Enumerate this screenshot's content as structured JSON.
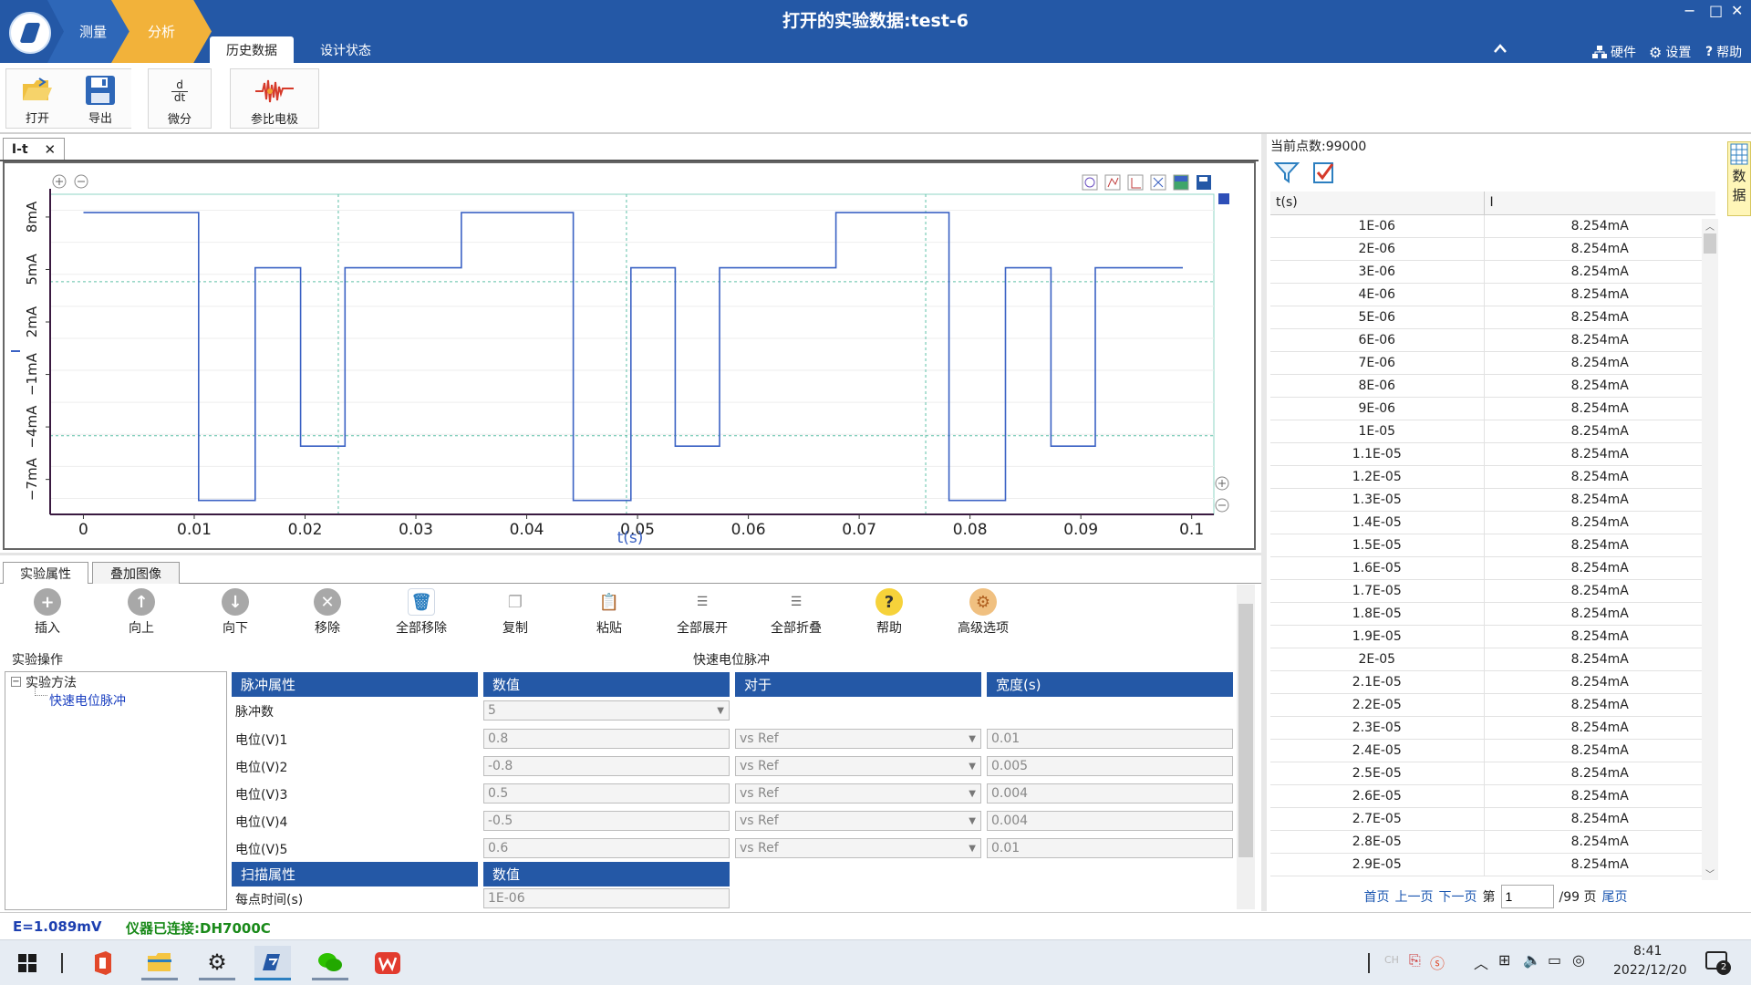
{
  "window": {
    "title": "打开的实验数据:test-6",
    "min": "−",
    "max": "□",
    "close": "✕"
  },
  "nav": {
    "measure": "测量",
    "analyze": "分析"
  },
  "ribbon_tabs": {
    "history": "历史数据",
    "design": "设计状态"
  },
  "top_right": {
    "hardware": "硬件",
    "settings": "设置",
    "help": "帮助"
  },
  "ribbon": {
    "open": "打开",
    "export": "导出",
    "derivative": "微分",
    "derivative_glyph_top": "d",
    "derivative_glyph_bottom": "dt",
    "reference": "参比电极"
  },
  "doc_tab": {
    "label": "I-t",
    "close": "✕"
  },
  "chart_data": {
    "type": "line",
    "xlabel": "t(s)",
    "ylabel": "I",
    "xlim": [
      -0.003,
      0.102
    ],
    "ylim": [
      -9,
      9.3
    ],
    "x_ticks": [
      "0",
      "0.01",
      "0.02",
      "0.03",
      "0.04",
      "0.05",
      "0.06",
      "0.07",
      "0.08",
      "0.09",
      "0.1"
    ],
    "y_ticks": [
      {
        "label": "8mA",
        "value": 8
      },
      {
        "label": "5mA",
        "value": 5
      },
      {
        "label": "2mA",
        "value": 2
      },
      {
        "label": "−1mA",
        "value": -1
      },
      {
        "label": "−4mA",
        "value": -4
      },
      {
        "label": "−7mA",
        "value": -7
      }
    ],
    "series": [
      {
        "color": "#3b62c4",
        "x": [
          0.0,
          0.0104,
          0.0104,
          0.0155,
          0.0155,
          0.0196,
          0.0196,
          0.0236,
          0.0236,
          0.0341,
          0.0341,
          0.0442,
          0.0442,
          0.0494,
          0.0494,
          0.0534,
          0.0534,
          0.0574,
          0.0574,
          0.0679,
          0.0679,
          0.0781,
          0.0781,
          0.0832,
          0.0832,
          0.0873,
          0.0873,
          0.0913,
          0.0913,
          0.0992
        ],
        "y": [
          8.25,
          8.25,
          -8.2,
          -8.2,
          5.1,
          5.1,
          -5.1,
          -5.1,
          5.1,
          5.1,
          8.25,
          8.25,
          -8.2,
          -8.2,
          5.1,
          5.1,
          -5.1,
          -5.1,
          5.1,
          5.1,
          8.25,
          8.25,
          -8.2,
          -8.2,
          5.1,
          5.1,
          -5.1,
          -5.1,
          5.1,
          5.1
        ]
      }
    ],
    "grid": true
  },
  "data_panel": {
    "point_count": "当前点数:99000",
    "col_t": "t(s)",
    "col_i": "I",
    "side_tab_1": "数",
    "side_tab_2": "据",
    "rows": [
      [
        "1E-06",
        "8.254mA"
      ],
      [
        "2E-06",
        "8.254mA"
      ],
      [
        "3E-06",
        "8.254mA"
      ],
      [
        "4E-06",
        "8.254mA"
      ],
      [
        "5E-06",
        "8.254mA"
      ],
      [
        "6E-06",
        "8.254mA"
      ],
      [
        "7E-06",
        "8.254mA"
      ],
      [
        "8E-06",
        "8.254mA"
      ],
      [
        "9E-06",
        "8.254mA"
      ],
      [
        "1E-05",
        "8.254mA"
      ],
      [
        "1.1E-05",
        "8.254mA"
      ],
      [
        "1.2E-05",
        "8.254mA"
      ],
      [
        "1.3E-05",
        "8.254mA"
      ],
      [
        "1.4E-05",
        "8.254mA"
      ],
      [
        "1.5E-05",
        "8.254mA"
      ],
      [
        "1.6E-05",
        "8.254mA"
      ],
      [
        "1.7E-05",
        "8.254mA"
      ],
      [
        "1.8E-05",
        "8.254mA"
      ],
      [
        "1.9E-05",
        "8.254mA"
      ],
      [
        "2E-05",
        "8.254mA"
      ],
      [
        "2.1E-05",
        "8.254mA"
      ],
      [
        "2.2E-05",
        "8.254mA"
      ],
      [
        "2.3E-05",
        "8.254mA"
      ],
      [
        "2.4E-05",
        "8.254mA"
      ],
      [
        "2.5E-05",
        "8.254mA"
      ],
      [
        "2.6E-05",
        "8.254mA"
      ],
      [
        "2.7E-05",
        "8.254mA"
      ],
      [
        "2.8E-05",
        "8.254mA"
      ],
      [
        "2.9E-05",
        "8.254mA"
      ]
    ],
    "pager": {
      "first": "首页",
      "prev": "上一页",
      "next": "下一页",
      "page_prefix": "第",
      "page_value": "1",
      "page_suffix": "/99 页",
      "last": "尾页"
    }
  },
  "lower_tabs": {
    "props": "实验属性",
    "overlay": "叠加图像"
  },
  "toolbar": {
    "insert": "插入",
    "up": "向上",
    "down": "向下",
    "remove": "移除",
    "remove_all": "全部移除",
    "copy": "复制",
    "paste": "粘贴",
    "expand_all": "全部展开",
    "collapse_all": "全部折叠",
    "help": "帮助",
    "advanced": "高级选项"
  },
  "ops": {
    "label": "实验操作",
    "title": "快速电位脉冲",
    "tree_root": "实验方法",
    "tree_child": "快速电位脉冲"
  },
  "pulse": {
    "hdr_props": "脉冲属性",
    "hdr_value": "数值",
    "hdr_ref": "对于",
    "hdr_width": "宽度(s)",
    "count_label": "脉冲数",
    "count_value": "5",
    "rows": [
      {
        "label": "电位(V)1",
        "value": "0.8",
        "ref": "vs Ref",
        "width": "0.01"
      },
      {
        "label": "电位(V)2",
        "value": "-0.8",
        "ref": "vs Ref",
        "width": "0.005"
      },
      {
        "label": "电位(V)3",
        "value": "0.5",
        "ref": "vs Ref",
        "width": "0.004"
      },
      {
        "label": "电位(V)4",
        "value": "-0.5",
        "ref": "vs Ref",
        "width": "0.004"
      },
      {
        "label": "电位(V)5",
        "value": "0.6",
        "ref": "vs Ref",
        "width": "0.01"
      }
    ],
    "scan_hdr": "扫描属性",
    "scan_value_hdr": "数值",
    "time_label": "每点时间(s)",
    "time_value": "1E-06"
  },
  "status": {
    "potential": "E=1.089mV",
    "instrument": "仪器已连接:DH7000C"
  },
  "taskbar": {
    "ime": "CH",
    "time": "8:41",
    "date": "2022/12/20",
    "notif_count": "2"
  },
  "colors": {
    "accent": "#2458a6",
    "nav_active": "#f2b23a",
    "series": "#3b62c4",
    "status_potential": "#1c3fb0",
    "status_instrument": "#1a8a1a"
  }
}
